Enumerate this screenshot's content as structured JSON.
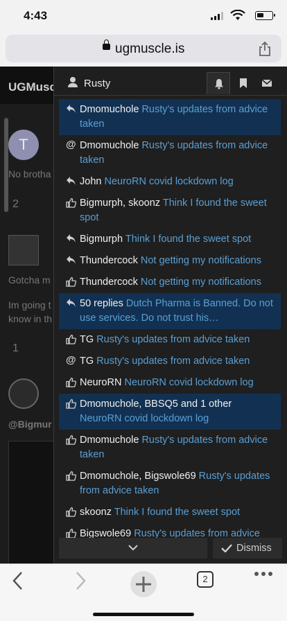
{
  "status": {
    "time": "4:43"
  },
  "browser": {
    "url": "ugmuscle.is",
    "tab_count": "2"
  },
  "background_page": {
    "brand": "UGMusc",
    "avatar_letter": "T",
    "snippet_1": "No brotha",
    "like_count_1": "2",
    "snippet_2": "Gotcha m",
    "snippet_3": "Im going t",
    "snippet_4": "know in th",
    "like_count_2": "1",
    "mention": "@Bigmur"
  },
  "panel": {
    "username": "Rusty",
    "dismiss_label": "Dismiss",
    "notifications": [
      {
        "icon": "reply-icon",
        "who": "Dmomuchole",
        "what": "Rusty's updates from advice taken",
        "unread": true
      },
      {
        "icon": "mention-icon",
        "who": "Dmomuchole",
        "what": "Rusty's updates from advice taken",
        "unread": false
      },
      {
        "icon": "reply-icon",
        "who": "John",
        "what": "NeuroRN covid lockdown log",
        "unread": false
      },
      {
        "icon": "like-icon",
        "who": "Bigmurph, skoonz",
        "what": "Think I found the sweet spot",
        "unread": false
      },
      {
        "icon": "reply-icon",
        "who": "Bigmurph",
        "what": "Think I found the sweet spot",
        "unread": false
      },
      {
        "icon": "reply-icon",
        "who": "Thundercock",
        "what": "Not getting my notifications",
        "unread": false
      },
      {
        "icon": "like-icon",
        "who": "Thundercock",
        "what": "Not getting my notifications",
        "unread": false
      },
      {
        "icon": "reply-icon",
        "who": "50 replies",
        "what": "Dutch Pharma is Banned. Do not use services. Do not trust his…",
        "unread": true
      },
      {
        "icon": "like-icon",
        "who": "TG",
        "what": "Rusty's updates from advice taken",
        "unread": false
      },
      {
        "icon": "mention-icon",
        "who": "TG",
        "what": "Rusty's updates from advice taken",
        "unread": false
      },
      {
        "icon": "like-icon",
        "who": "NeuroRN",
        "what": "NeuroRN covid lockdown log",
        "unread": false
      },
      {
        "icon": "like-icon",
        "who": "Dmomuchole, BBSQ5 and 1 other",
        "what": "NeuroRN covid lockdown log",
        "unread": true
      },
      {
        "icon": "like-icon",
        "who": "Dmomuchole",
        "what": "Rusty's updates from advice taken",
        "unread": false
      },
      {
        "icon": "like-icon",
        "who": "Dmomuchole, Bigswole69",
        "what": "Rusty's updates from advice taken",
        "unread": false
      },
      {
        "icon": "like-icon",
        "who": "skoonz",
        "what": "Think I found the sweet spot",
        "unread": false
      },
      {
        "icon": "like-icon",
        "who": "Bigswole69",
        "what": "Rusty's updates from advice taken",
        "unread": false
      }
    ]
  }
}
